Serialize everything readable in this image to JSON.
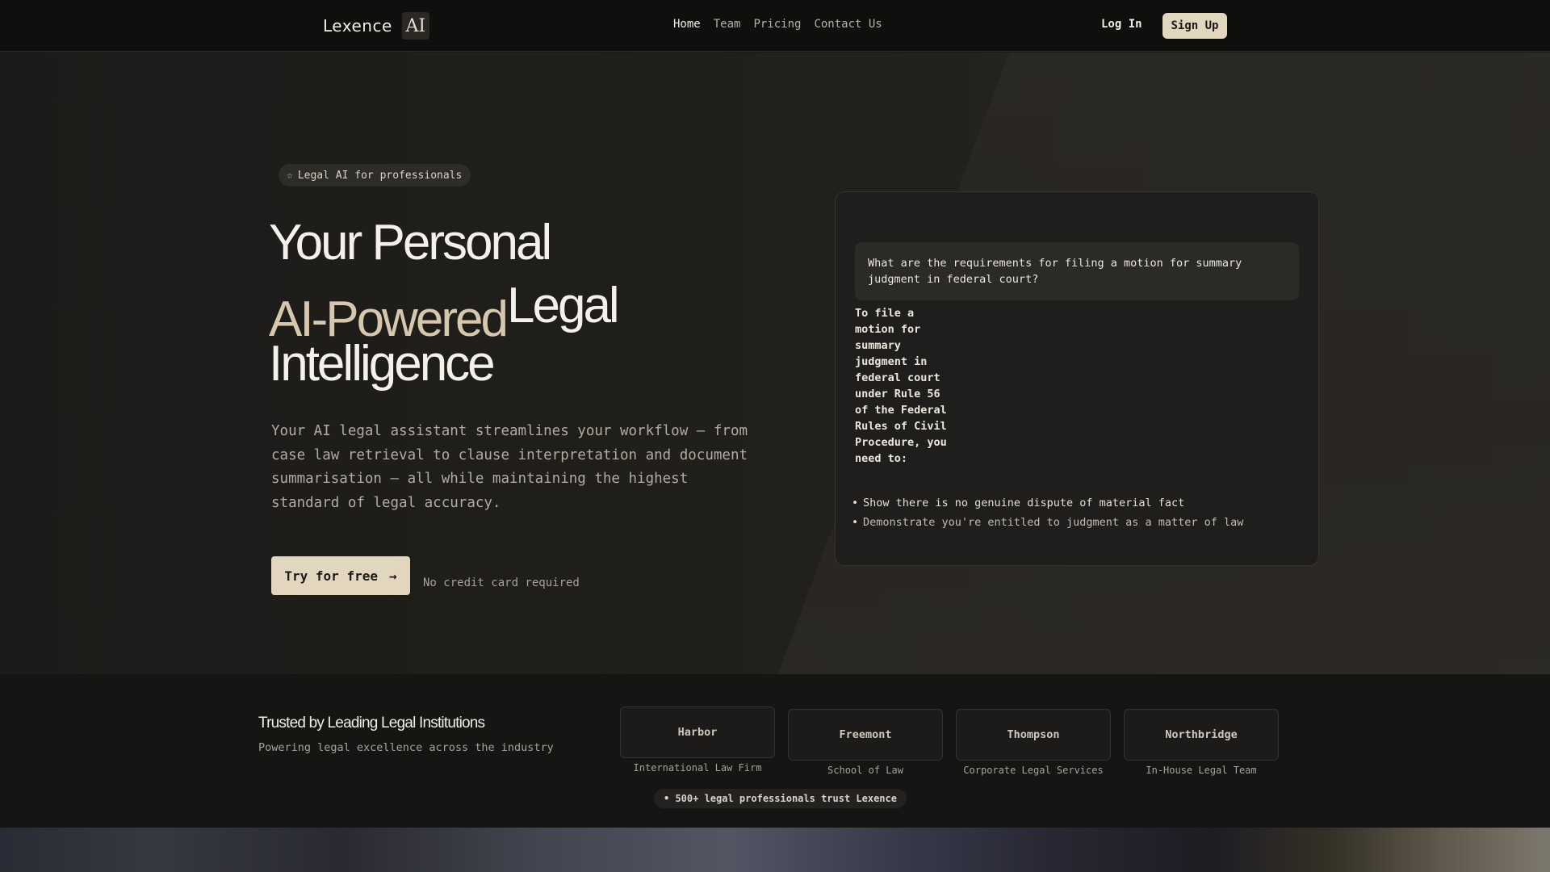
{
  "nav": {
    "brand": "Lexence",
    "logo_text": "AI",
    "links": [
      "Home",
      "Team",
      "Pricing",
      "Contact Us"
    ],
    "login": "Log In",
    "signup": "Sign Up"
  },
  "hero": {
    "badge": "Legal AI for professionals",
    "title_line1": "Your Personal",
    "title_line2_accent": "AI-Powered",
    "title_line2_rest": "Legal",
    "title_line3": "Intelligence",
    "description": "Your AI legal assistant streamlines your workflow — from case law retrieval to clause interpretation and document summarisation — all while maintaining the highest standard of legal accuracy.",
    "cta": "Try for free",
    "cta_note": "No credit card required"
  },
  "chat": {
    "question": "What are the requirements for filing a motion for summary judgment in federal court?",
    "answer": "To file a motion for summary judgment in federal court under Rule 56 of the Federal Rules of Civil Procedure, you need to:",
    "bullets": [
      "Show there is no genuine dispute of material fact",
      "Demonstrate you're entitled to judgment as a matter of law"
    ]
  },
  "trust": {
    "title": "Trusted by Leading Legal Institutions",
    "subtitle": "Powering legal excellence across the industry",
    "firms": [
      {
        "name": "Harbor",
        "type": "International Law Firm"
      },
      {
        "name": "Freemont",
        "type": "School of Law"
      },
      {
        "name": "Thompson",
        "type": "Corporate Legal Services"
      },
      {
        "name": "Northbridge",
        "type": "In-House Legal Team"
      }
    ],
    "pill": "• 500+ legal professionals trust Lexence"
  },
  "icons": {
    "badge_icon": "star-icon",
    "cta_icon": "arrow-right-icon"
  }
}
